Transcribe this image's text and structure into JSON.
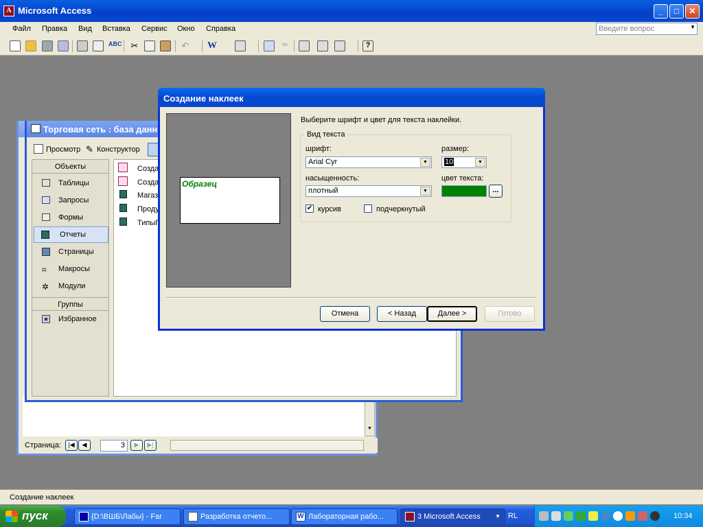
{
  "app": {
    "title": "Microsoft Access",
    "icon_text": "A"
  },
  "menu": [
    "Файл",
    "Правка",
    "Вид",
    "Вставка",
    "Сервис",
    "Окно",
    "Справка"
  ],
  "ask_placeholder": "Введите вопрос",
  "toolbar_icons": [
    "new-icon",
    "open-icon",
    "save-icon",
    "file-search-icon",
    "print-icon",
    "print-preview-icon",
    "spelling-icon",
    "cut-icon",
    "copy-icon",
    "paste-icon",
    "undo-icon",
    "office-links-icon",
    "analyze-icon",
    "code-icon",
    "script-icon",
    "properties-icon",
    "relationships-icon",
    "new-object-icon",
    "help-icon"
  ],
  "db_window": {
    "title": "Торговая сеть : база данных",
    "buttons": {
      "preview": "Просмотр",
      "design": "Конструктор"
    },
    "objects_header": "Объекты",
    "objects": [
      "Таблицы",
      "Запросы",
      "Формы",
      "Отчеты",
      "Страницы",
      "Макросы",
      "Модули"
    ],
    "groups_header": "Группы",
    "groups": [
      "Избранное"
    ],
    "items": [
      "Созда",
      "Созда",
      "Магаз",
      "Проду",
      "ТипыП"
    ]
  },
  "report_window": {
    "page_label": "Страница:",
    "page_value": "3"
  },
  "wizard": {
    "title": "Создание наклеек",
    "instruction": "Выберите шрифт и цвет для текста наклейки.",
    "sample_text": "Образец",
    "group_label": "Вид текста",
    "font_label": "шрифт:",
    "font_value": "Arial Cyr",
    "size_label": "размер:",
    "size_value": "10",
    "weight_label": "насыщенность:",
    "weight_value": "плотный",
    "color_label": "цвет текста:",
    "color_value": "#008000",
    "color_btn": "...",
    "italic_label": "курсив",
    "italic_checked": "✔",
    "underline_label": "подчеркнутый",
    "buttons": {
      "cancel": "Отмена",
      "back": "< Назад",
      "next": "Далее >",
      "finish": "Готово"
    }
  },
  "status": "Создание наклеек",
  "taskbar": {
    "start": "пуск",
    "tasks": [
      {
        "label": "{D:\\ВШБ\\Лабы} - Far",
        "icon": "far-icon"
      },
      {
        "label": "Разработка отчето...",
        "icon": "document-icon"
      },
      {
        "label": "Лабораторная рабо...",
        "icon": "word-icon"
      },
      {
        "label": "3 Microsoft Access",
        "icon": "access-icon"
      }
    ],
    "lang": "RL",
    "clock": "10:34"
  }
}
